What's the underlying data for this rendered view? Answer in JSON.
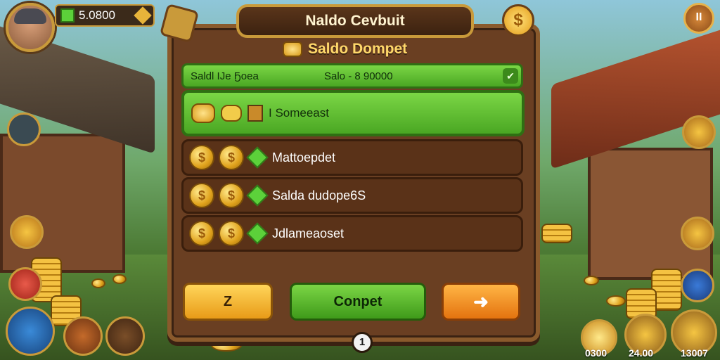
{
  "hud": {
    "balance": "5.0800",
    "top_right_icon": "pause-icon",
    "top_right_glyph": "II"
  },
  "panel": {
    "title": "Naldo Cevbuit",
    "coin_glyph": "$",
    "subtitle": "Saldo Dompet",
    "search_label": "Saldl ΙЈе Ҕоеа",
    "search_value": "Salo - 8 90000",
    "search_go": "✔",
    "featured_label": "I Someeast",
    "rows": [
      {
        "coin_glyph": "$",
        "label": "Mattoepdet"
      },
      {
        "coin_glyph": "$",
        "label": "Salda dudope6S"
      },
      {
        "coin_glyph": "$",
        "label": "Jdlameaoset"
      }
    ],
    "btn_z": "Z",
    "btn_confirm": "Conpet",
    "btn_next": "➜",
    "page": "1"
  },
  "bottom_bar": [
    {
      "icon": "coin-icon",
      "value": "0300"
    },
    {
      "icon": "gold-bag-icon",
      "value": "24.00"
    },
    {
      "icon": "gold-pile-icon",
      "value": "13007"
    }
  ],
  "colors": {
    "panel_bg": "#6a3f22",
    "green": "#5cd13a",
    "gold": "#e0a21c",
    "orange": "#e4730f"
  }
}
